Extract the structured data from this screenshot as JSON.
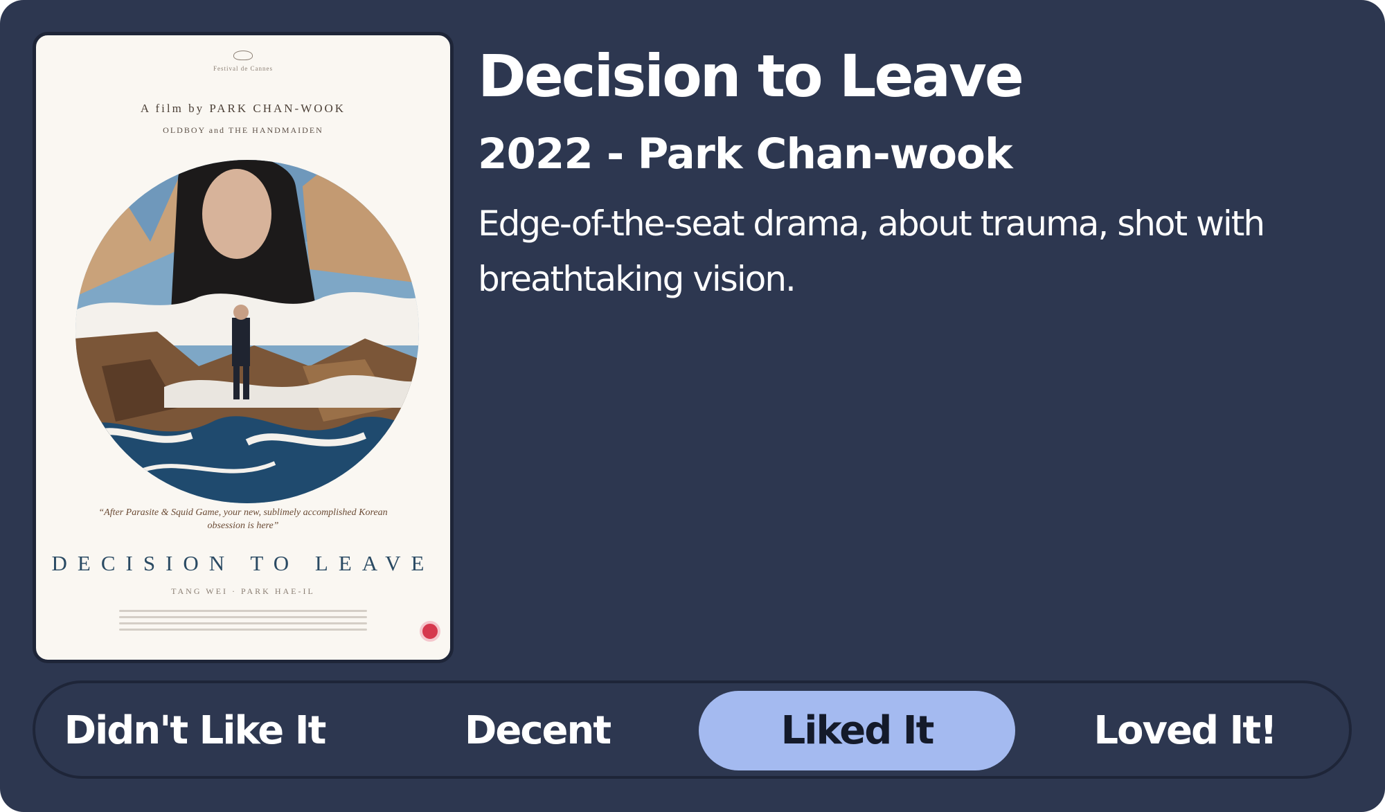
{
  "movie": {
    "title": "Decision to Leave",
    "subtitle": "2022 - Park Chan-wook",
    "description": "Edge-of-the-seat drama, about trauma, shot with breathtaking vision."
  },
  "poster": {
    "festival": "Festival de Cannes",
    "director_line": "A film by PARK CHAN-WOOK",
    "previous_works": "OLDBOY and THE HANDMAIDEN",
    "quote": "“After Parasite & Squid Game, your new, sublimely accomplished Korean obsession is here”",
    "title": "DECISION TO LEAVE",
    "cast": "TANG WEI · PARK HAE-IL"
  },
  "rating": {
    "options": [
      {
        "label": "Didn't Like It",
        "selected": false
      },
      {
        "label": "Decent",
        "selected": false
      },
      {
        "label": "Liked It",
        "selected": true
      },
      {
        "label": "Loved It!",
        "selected": false
      }
    ],
    "selected_color": "#a4baf0"
  },
  "colors": {
    "background": "#2d3750",
    "text": "#ffffff",
    "border": "#1e2538"
  }
}
